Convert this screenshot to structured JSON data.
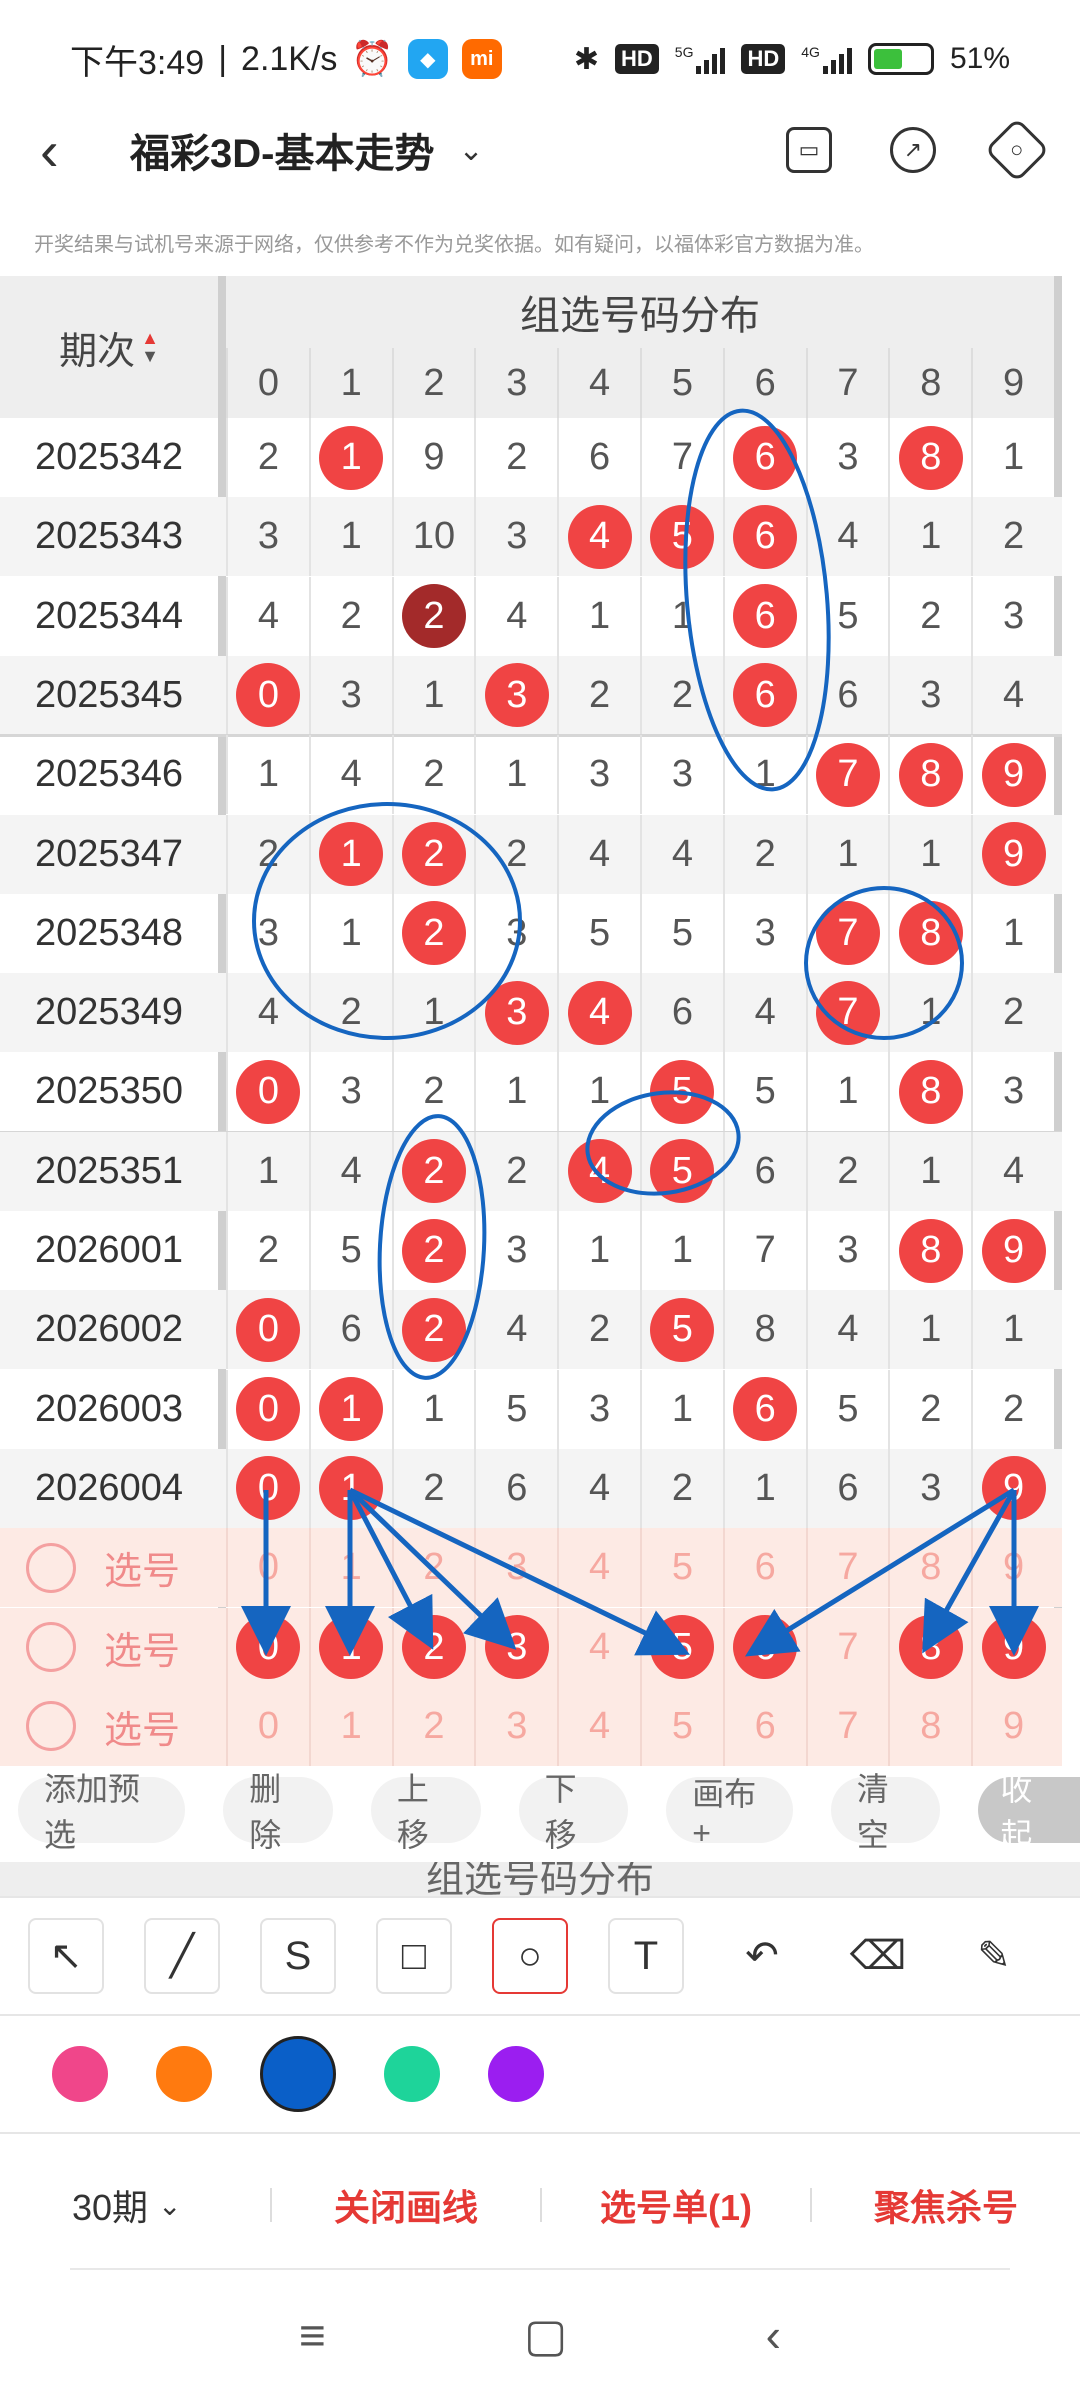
{
  "status": {
    "time": "下午3:49",
    "speed": "2.1K/s",
    "battery": "51%",
    "net1": "5G",
    "net2": "4G",
    "hd": "HD"
  },
  "header": {
    "title": "福彩3D-基本走势",
    "disclaimer": "开奖结果与试机号来源于网络，仅供参考不作为兑奖依据。如有疑问，以福体彩官方数据为准。"
  },
  "table": {
    "period_label": "期次",
    "group_title": "组选号码分布",
    "digits": [
      "0",
      "1",
      "2",
      "3",
      "4",
      "5",
      "6",
      "7",
      "8",
      "9"
    ],
    "rows": [
      {
        "id": "2025342",
        "cells": [
          "2",
          "1",
          "9",
          "2",
          "6",
          "7",
          "6",
          "3",
          "8",
          "1"
        ],
        "hits": [
          1,
          6,
          8
        ]
      },
      {
        "id": "2025343",
        "cells": [
          "3",
          "1",
          "10",
          "3",
          "4",
          "5",
          "6",
          "4",
          "1",
          "2"
        ],
        "hits": [
          4,
          5,
          6
        ]
      },
      {
        "id": "2025344",
        "cells": [
          "4",
          "2",
          "2",
          "4",
          "1",
          "1",
          "6",
          "5",
          "2",
          "3"
        ],
        "hits": [
          2,
          6
        ],
        "dark": [
          2
        ]
      },
      {
        "id": "2025345",
        "cells": [
          "0",
          "3",
          "1",
          "3",
          "2",
          "2",
          "6",
          "6",
          "3",
          "4"
        ],
        "hits": [
          0,
          3,
          6
        ]
      },
      {
        "id": "2025346",
        "cells": [
          "1",
          "4",
          "2",
          "1",
          "3",
          "3",
          "1",
          "7",
          "8",
          "9"
        ],
        "hits": [
          7,
          8,
          9
        ]
      },
      {
        "id": "2025347",
        "cells": [
          "2",
          "1",
          "2",
          "2",
          "4",
          "4",
          "2",
          "1",
          "1",
          "9"
        ],
        "hits": [
          1,
          2,
          9
        ]
      },
      {
        "id": "2025348",
        "cells": [
          "3",
          "1",
          "2",
          "3",
          "5",
          "5",
          "3",
          "7",
          "8",
          "1"
        ],
        "hits": [
          2,
          7,
          8
        ]
      },
      {
        "id": "2025349",
        "cells": [
          "4",
          "2",
          "1",
          "3",
          "4",
          "6",
          "4",
          "7",
          "1",
          "2"
        ],
        "hits": [
          3,
          4,
          7
        ]
      },
      {
        "id": "2025350",
        "cells": [
          "0",
          "3",
          "2",
          "1",
          "1",
          "5",
          "5",
          "1",
          "8",
          "3"
        ],
        "hits": [
          0,
          5,
          8
        ]
      },
      {
        "id": "2025351",
        "cells": [
          "1",
          "4",
          "2",
          "2",
          "4",
          "5",
          "6",
          "2",
          "1",
          "4"
        ],
        "hits": [
          2,
          4,
          5
        ]
      },
      {
        "id": "2026001",
        "cells": [
          "2",
          "5",
          "2",
          "3",
          "1",
          "1",
          "7",
          "3",
          "8",
          "9"
        ],
        "hits": [
          2,
          8,
          9
        ]
      },
      {
        "id": "2026002",
        "cells": [
          "0",
          "6",
          "2",
          "4",
          "2",
          "5",
          "8",
          "4",
          "1",
          "1"
        ],
        "hits": [
          0,
          2,
          5
        ]
      },
      {
        "id": "2026003",
        "cells": [
          "0",
          "1",
          "1",
          "5",
          "3",
          "1",
          "6",
          "5",
          "2",
          "2"
        ],
        "hits": [
          0,
          1,
          6
        ]
      },
      {
        "id": "2026004",
        "cells": [
          "0",
          "1",
          "2",
          "6",
          "4",
          "2",
          "1",
          "6",
          "3",
          "9"
        ],
        "hits": [
          0,
          1,
          9
        ]
      }
    ],
    "selector_label": "选号",
    "selectors": [
      {
        "hits": []
      },
      {
        "hits": [
          0,
          1,
          2,
          3,
          5,
          6,
          8,
          9
        ]
      },
      {
        "hits": []
      }
    ]
  },
  "chips": [
    "添加预选",
    "删除",
    "上移",
    "下移",
    "画布+",
    "清空",
    "收起"
  ],
  "peek_text": "组选号码分布",
  "tools": [
    "arrow-tool-icon",
    "line-tool-icon",
    "curve-tool-icon",
    "rectangle-tool-icon",
    "circle-tool-icon",
    "text-tool-icon",
    "undo-icon",
    "eraser-icon",
    "clear-brush-icon"
  ],
  "colors": [
    "#f0468a",
    "#ff7a0f",
    "#0a5fc8",
    "#1ed49a",
    "#9b1ef0"
  ],
  "selected_color": "#0a5fc8",
  "bottom": {
    "period": "30期",
    "close_lines": "关闭画线",
    "pick_list": "选号单(1)",
    "focus_kill": "聚焦杀号"
  }
}
